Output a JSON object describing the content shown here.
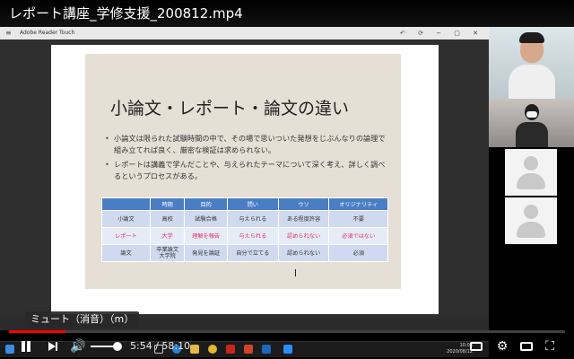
{
  "video": {
    "title": "レポート講座_学修支援_200812.mp4"
  },
  "app": {
    "title": "Adobe Reader Touch",
    "window_controls": "↶ ⟳ − ▢ ✕"
  },
  "slide": {
    "title": "小論文・レポート・論文の違い",
    "bullets": [
      "小論文は限られた試験時間の中で、その場で思いついた発想をじぶんなりの論理で組み立てれば良く、厳密な検証は求められない。",
      "レポートは講義で学んだことや、与えられたテーマについて深く考え、詳しく調べるというプロセスがある。"
    ],
    "table": {
      "headers": [
        "",
        "時期",
        "目的",
        "問い",
        "ウソ",
        "オリジナリティ"
      ],
      "rows": [
        [
          "小論文",
          "高校",
          "試験合格",
          "与えられる",
          "ある程度許容",
          "不要"
        ],
        [
          "レポート",
          "大学",
          "理解を報告",
          "与えられる",
          "認められない",
          "必須ではない"
        ],
        [
          "論文",
          "卒業論文\n大学院",
          "発見を論証",
          "自分で立てる",
          "認められない",
          "必須"
        ]
      ]
    }
  },
  "taskbar": {
    "time": "10:06",
    "date": "2020/08/12"
  },
  "tooltip": {
    "text": "ミュート（消音）（m）"
  },
  "player": {
    "current_time": "5:54",
    "separator": " / ",
    "duration": "58:10",
    "progress_fraction": 0.101
  },
  "icons": {
    "play_pause": "pause-icon",
    "next": "next-icon",
    "volume": "volume-icon",
    "subtitles": "subtitles-icon",
    "settings": "settings-icon",
    "miniplayer": "miniplayer-icon",
    "fullscreen": "fullscreen-icon"
  },
  "colors": {
    "progress": "#ff0000",
    "table_header": "#4a7ec4",
    "highlight_row": "#e0306b"
  }
}
